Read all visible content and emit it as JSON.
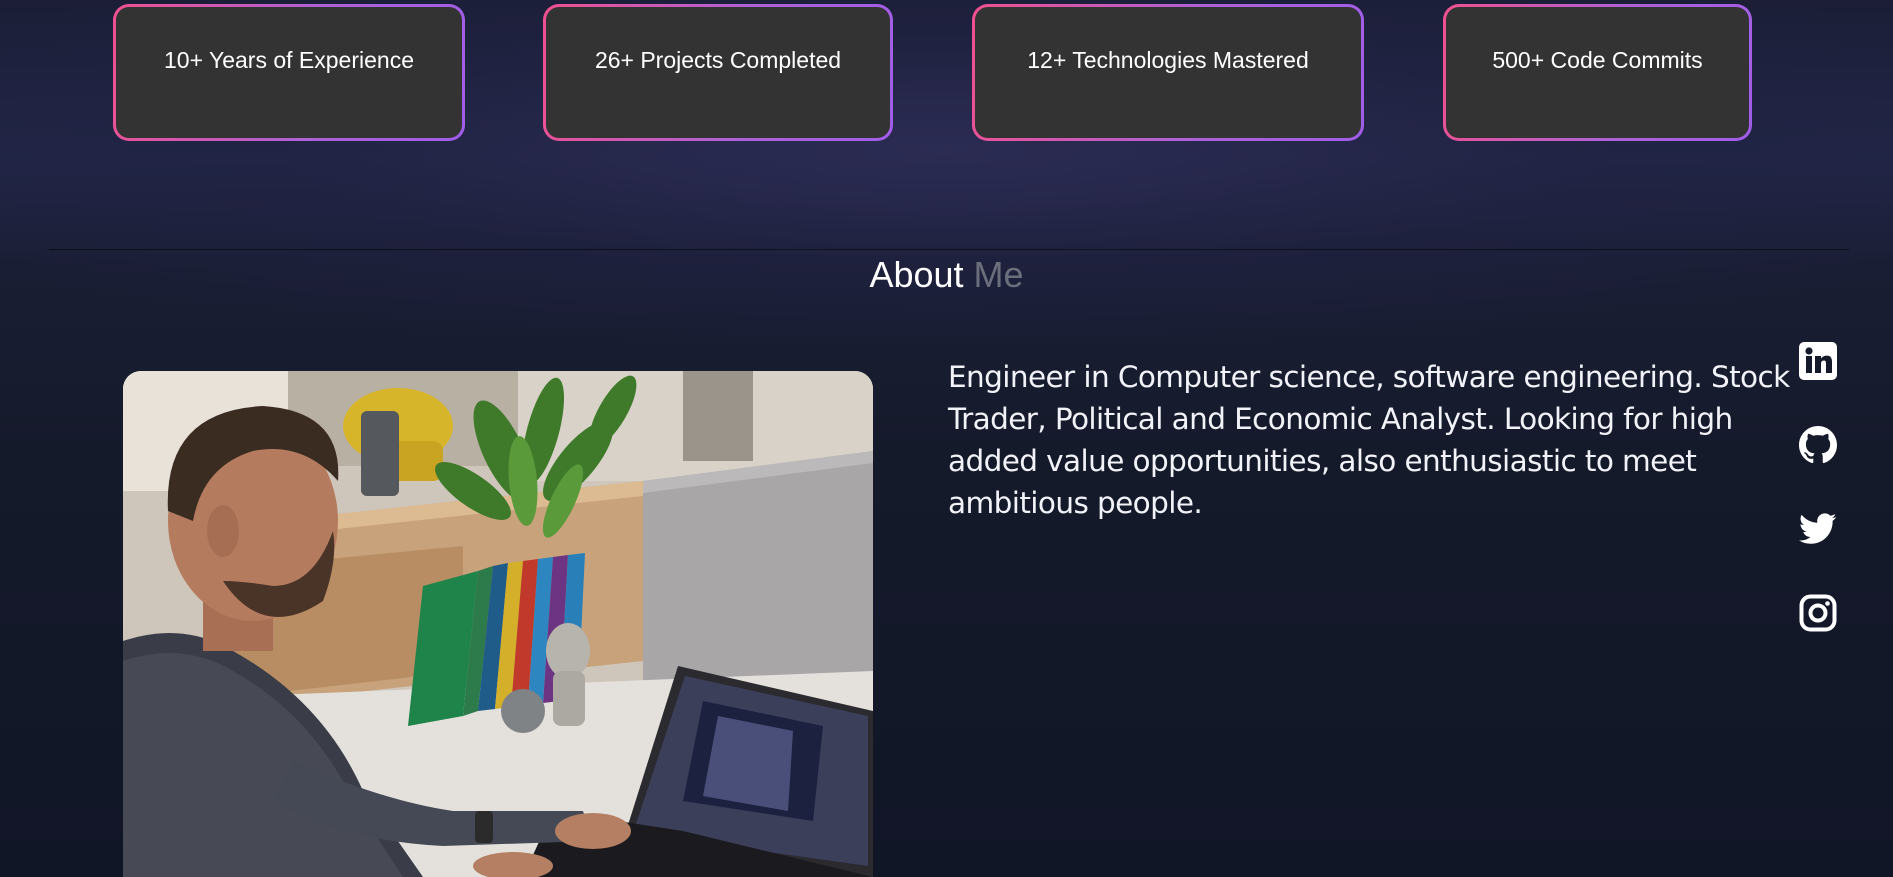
{
  "stats": [
    {
      "label": "10+ Years of Experience"
    },
    {
      "label": "26+ Projects Completed"
    },
    {
      "label": "12+ Technologies Mastered"
    },
    {
      "label": "500+ Code Commits"
    }
  ],
  "about": {
    "title_primary": "About",
    "title_secondary": "Me",
    "bio": "Engineer in Computer science, software engineering. Stock Trader, Political and Economic Analyst. Looking for high added value opportunities, also enthusiastic to meet ambitious people.",
    "photo": {
      "icon": "profile-photo"
    }
  },
  "social": [
    {
      "icon": "linkedin-icon"
    },
    {
      "icon": "github-icon"
    },
    {
      "icon": "twitter-icon"
    },
    {
      "icon": "instagram-icon"
    }
  ],
  "colors": {
    "card_background": "#333333",
    "card_border_start": "#f0508f",
    "card_border_end": "#a05de8",
    "title_secondary": "#6b6f7c",
    "page_background": "#151a2b"
  }
}
